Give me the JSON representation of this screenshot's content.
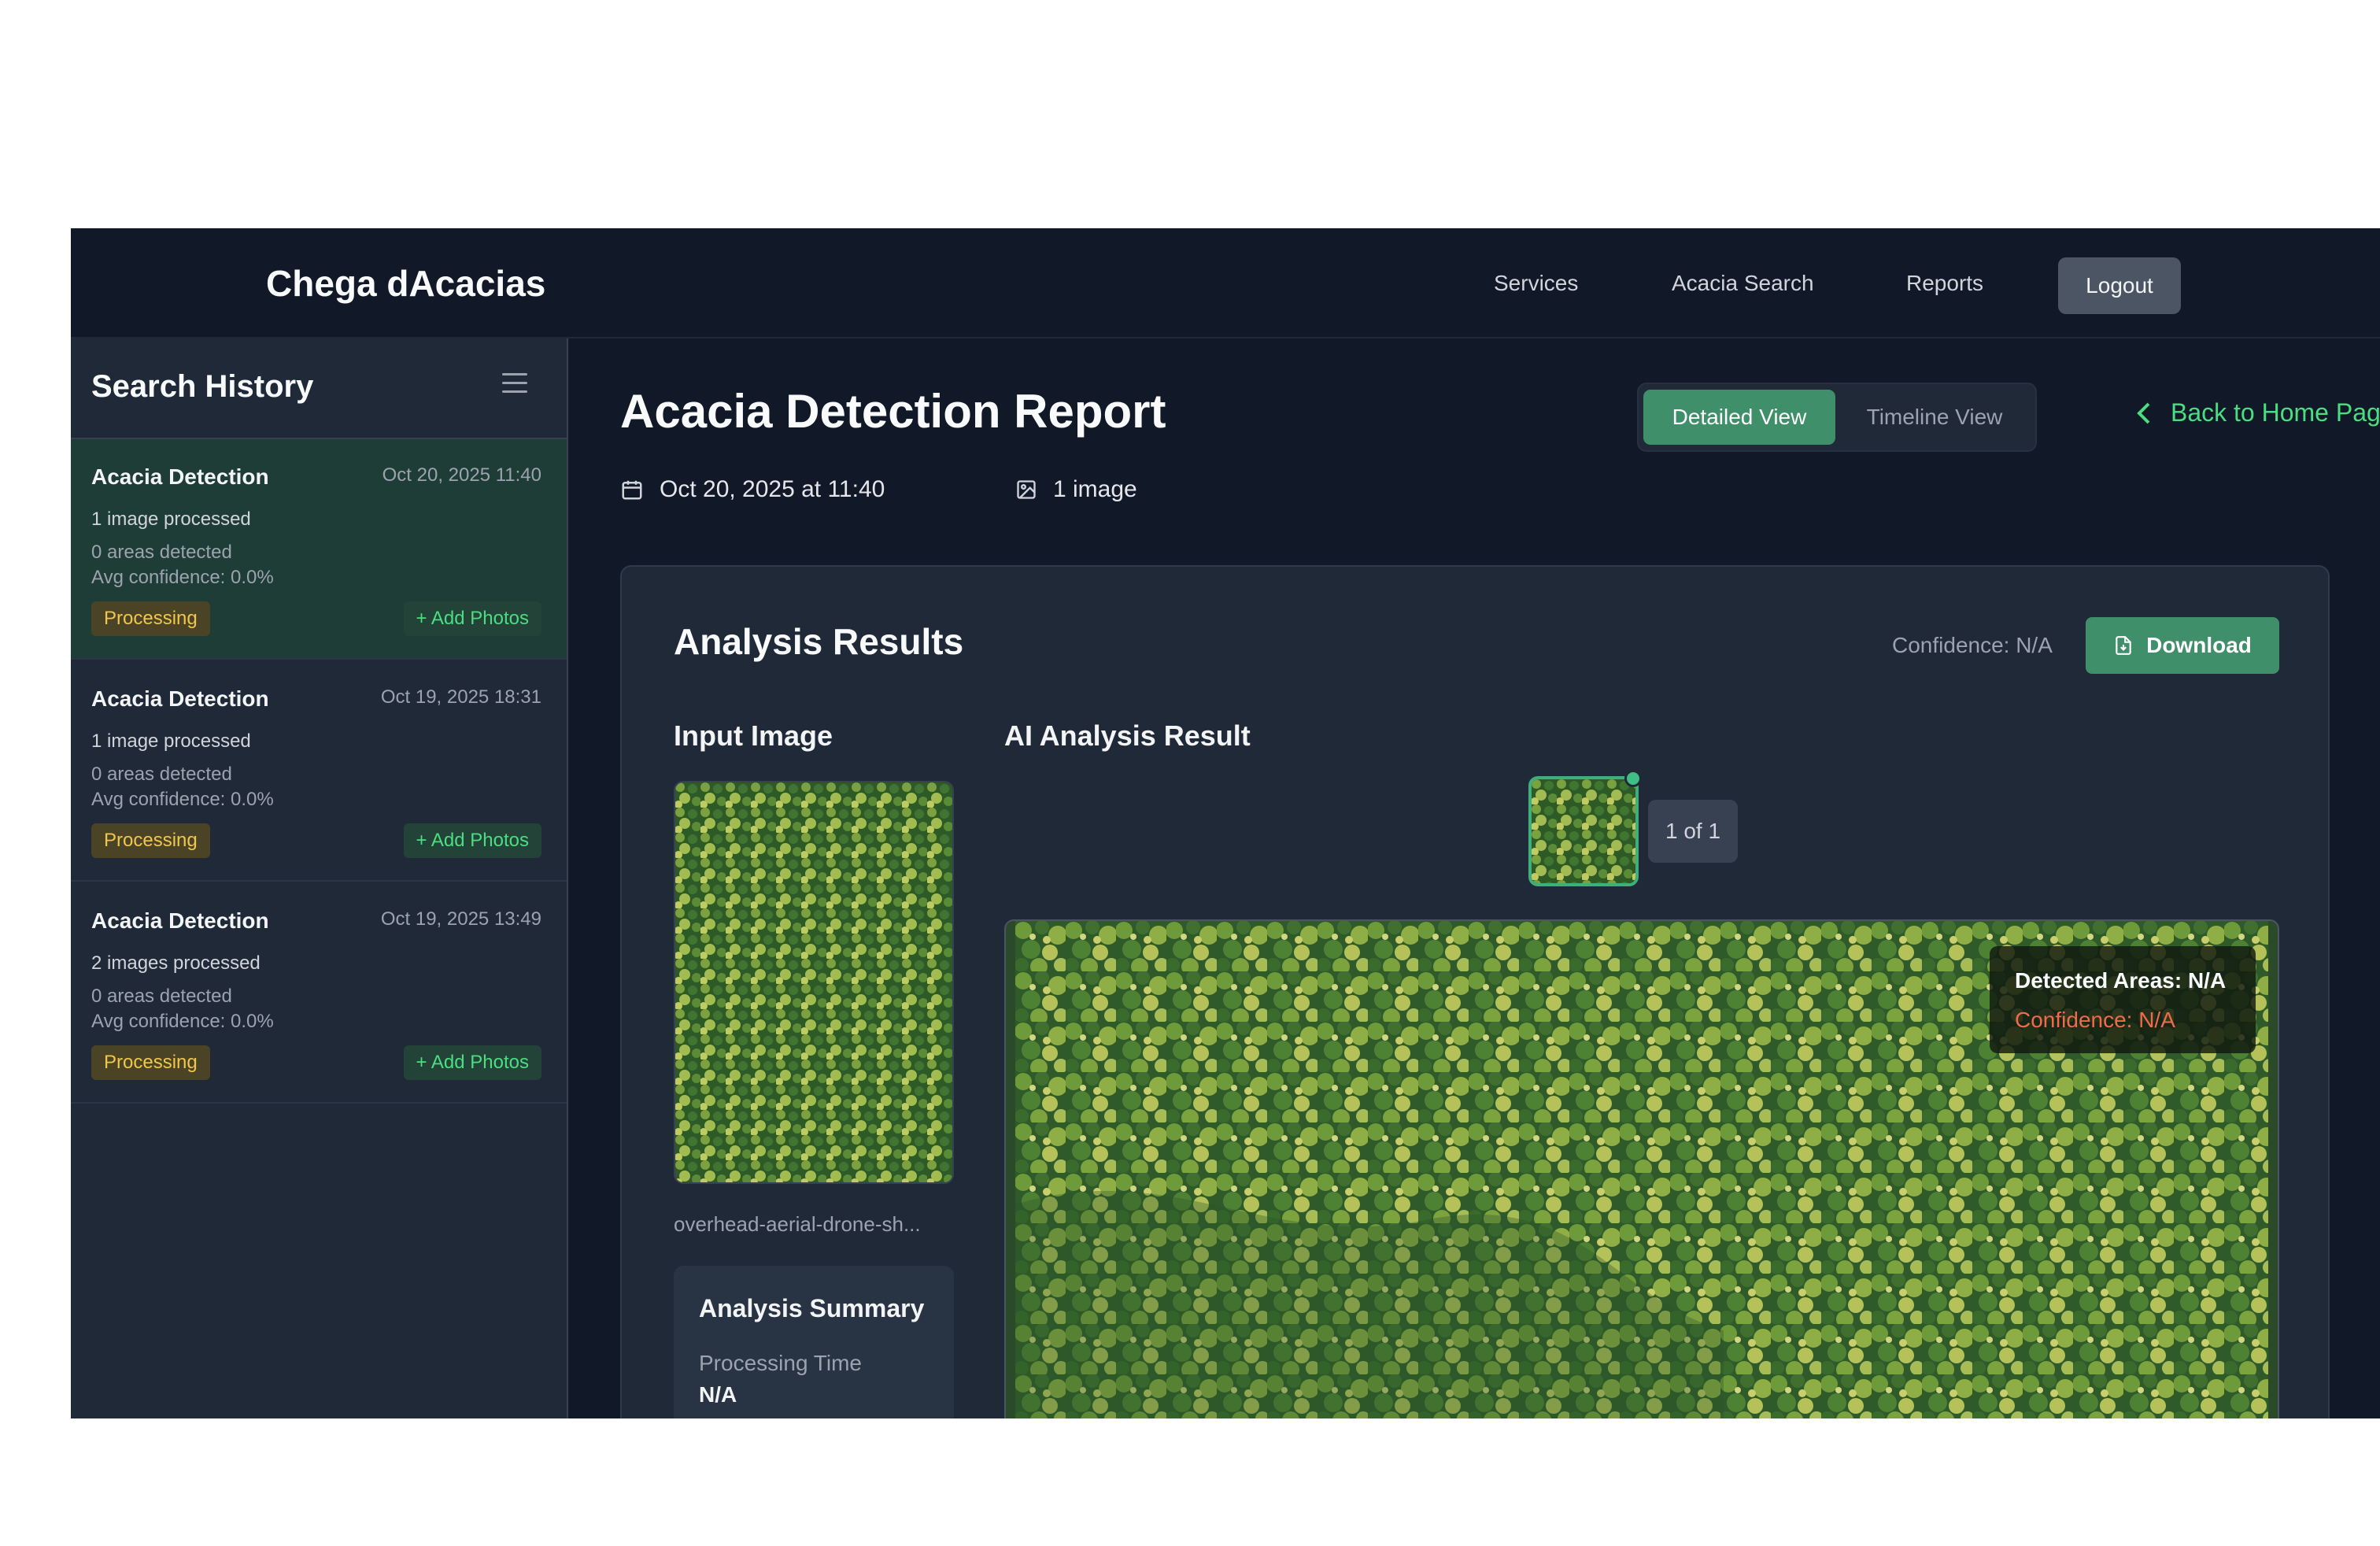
{
  "app": {
    "brand": "Chega dAcacias"
  },
  "nav": {
    "links": [
      "Services",
      "Acacia Search",
      "Reports"
    ],
    "logout_label": "Logout"
  },
  "sidebar": {
    "title": "Search History",
    "items": [
      {
        "title": "Acacia Detection",
        "date": "Oct 20, 2025 11:40",
        "processed": "1 image processed",
        "areas": "0 areas detected",
        "confidence": "Avg confidence: 0.0%",
        "status": "Processing",
        "add_label": "+ Add Photos",
        "active": true
      },
      {
        "title": "Acacia Detection",
        "date": "Oct 19, 2025 18:31",
        "processed": "1 image processed",
        "areas": "0 areas detected",
        "confidence": "Avg confidence: 0.0%",
        "status": "Processing",
        "add_label": "+ Add Photos",
        "active": false
      },
      {
        "title": "Acacia Detection",
        "date": "Oct 19, 2025 13:49",
        "processed": "2 images processed",
        "areas": "0 areas detected",
        "confidence": "Avg confidence: 0.0%",
        "status": "Processing",
        "add_label": "+ Add Photos",
        "active": false
      }
    ]
  },
  "report": {
    "title": "Acacia Detection Report",
    "date": "Oct 20, 2025 at 11:40",
    "image_count": "1 image",
    "views": {
      "detailed": "Detailed View",
      "timeline": "Timeline View",
      "active": "detailed"
    },
    "back_label": "Back to Home Page"
  },
  "results": {
    "title": "Analysis Results",
    "confidence_label": "Confidence: N/A",
    "download_label": "Download",
    "input_title": "Input Image",
    "ai_title": "AI Analysis Result",
    "file_name": "overhead-aerial-drone-sh...",
    "pager": "1 of 1",
    "summary": {
      "title": "Analysis Summary",
      "processing_time_label": "Processing Time",
      "processing_time_value": "N/A"
    },
    "overlay": {
      "areas": "Detected Areas: N/A",
      "confidence": "Confidence: N/A"
    }
  },
  "colors": {
    "accent": "#3f8f6a",
    "accent_text": "#4ade80",
    "background": "#111827",
    "panel": "#1f2937",
    "badge_processing": "#f0c74a",
    "overlay_confidence": "#ef6b4a"
  },
  "icons": [
    "menu-icon",
    "calendar-icon",
    "image-icon",
    "chevron-left-icon",
    "file-download-icon"
  ]
}
